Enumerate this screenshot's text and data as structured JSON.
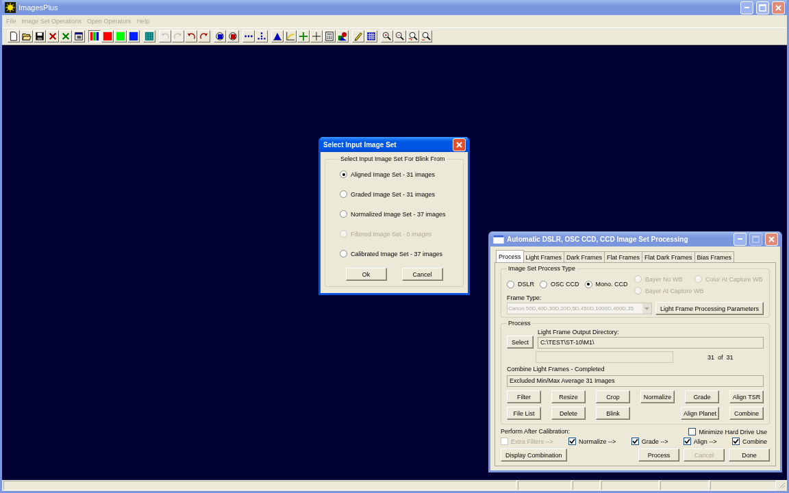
{
  "window": {
    "title": "ImagesPlus",
    "active": false
  },
  "menu": [
    {
      "label": "File",
      "disabled": true
    },
    {
      "label": "Image Set Operations",
      "disabled": true
    },
    {
      "label": "Open Operators",
      "disabled": true
    },
    {
      "label": "Help",
      "disabled": true
    }
  ],
  "toolbar": [
    [
      {
        "kind": "new",
        "disabled": false,
        "pressed": false
      },
      {
        "kind": "open",
        "disabled": false,
        "pressed": false
      },
      {
        "kind": "save",
        "disabled": false,
        "pressed": false
      },
      {
        "kind": "delete",
        "color": "#c00000",
        "disabled": false,
        "pressed": false
      },
      {
        "kind": "delete",
        "color": "#008000",
        "disabled": false,
        "pressed": false
      },
      {
        "kind": "window",
        "disabled": false,
        "pressed": false
      }
    ],
    [
      {
        "kind": "rgb",
        "disabled": false,
        "pressed": true
      },
      {
        "kind": "swatch",
        "color": "#ff0000",
        "disabled": false,
        "pressed": false
      },
      {
        "kind": "swatch",
        "color": "#00ff00",
        "disabled": false,
        "pressed": false
      },
      {
        "kind": "swatch",
        "color": "#0020ff",
        "disabled": false,
        "pressed": false
      }
    ],
    [
      {
        "kind": "dotted-square",
        "disabled": false,
        "pressed": false
      }
    ],
    [
      {
        "kind": "undo",
        "disabled": true,
        "pressed": false
      },
      {
        "kind": "redo",
        "disabled": true,
        "pressed": false
      },
      {
        "kind": "undo",
        "disabled": false,
        "pressed": false
      },
      {
        "kind": "redo",
        "disabled": false,
        "pressed": false
      }
    ],
    [
      {
        "kind": "circle",
        "color": "#0000c0",
        "disabled": false,
        "pressed": false
      },
      {
        "kind": "circle",
        "color": "#c00000",
        "disabled": false,
        "pressed": false
      }
    ],
    [
      {
        "kind": "dots",
        "disabled": false,
        "pressed": false
      },
      {
        "kind": "dot-pattern",
        "disabled": false,
        "pressed": false
      }
    ],
    [
      {
        "kind": "histogram",
        "disabled": false,
        "pressed": false
      },
      {
        "kind": "curve",
        "disabled": false,
        "pressed": false
      },
      {
        "kind": "plus",
        "disabled": false,
        "pressed": false
      },
      {
        "kind": "crosshair",
        "disabled": false,
        "pressed": false
      },
      {
        "kind": "calculator",
        "disabled": false,
        "pressed": false
      },
      {
        "kind": "shapes",
        "disabled": false,
        "pressed": false
      }
    ],
    [
      {
        "kind": "pencil",
        "disabled": false,
        "pressed": false
      },
      {
        "kind": "grid",
        "disabled": false,
        "pressed": false
      }
    ],
    [
      {
        "kind": "zoom-in",
        "disabled": false,
        "pressed": false
      },
      {
        "kind": "zoom-out",
        "disabled": false,
        "pressed": false
      },
      {
        "kind": "zoom-fit",
        "disabled": false,
        "pressed": false
      },
      {
        "kind": "zoom-reduce",
        "disabled": false,
        "pressed": false
      }
    ]
  ],
  "select_dialog": {
    "title": "Select Input Image Set",
    "active": true,
    "group_label": "Select Input Image Set For Blink From",
    "options": [
      {
        "label": "Aligned Image Set - 31 images",
        "selected": true,
        "disabled": false
      },
      {
        "label": "Graded Image Set - 31 images",
        "selected": false,
        "disabled": false
      },
      {
        "label": "Normalized Image Set - 37 images",
        "selected": false,
        "disabled": false
      },
      {
        "label": "Filtered Image Set - 0 images",
        "selected": false,
        "disabled": true
      },
      {
        "label": "Calibrated Image Set - 37 images",
        "selected": false,
        "disabled": false
      }
    ],
    "buttons": [
      {
        "label": "Ok",
        "disabled": false
      },
      {
        "label": "Cancel",
        "disabled": false
      }
    ]
  },
  "processing_dialog": {
    "title": "Automatic DSLR, OSC CCD, CCD Image Set Processing",
    "active": false,
    "tabs": [
      {
        "label": "Process",
        "selected": true
      },
      {
        "label": "Light Frames",
        "selected": false
      },
      {
        "label": "Dark Frames",
        "selected": false
      },
      {
        "label": "Flat Frames",
        "selected": false
      },
      {
        "label": "Flat Dark Frames",
        "selected": false
      },
      {
        "label": "Bias Frames",
        "selected": false
      }
    ],
    "process_type": {
      "label": "Image Set Process Type",
      "options": [
        {
          "label": "DSLR",
          "selected": false,
          "disabled": false
        },
        {
          "label": "OSC CCD",
          "selected": false,
          "disabled": false
        },
        {
          "label": "Mono. CCD",
          "selected": true,
          "disabled": false
        }
      ],
      "bayer_options": [
        {
          "label": "Bayer No WB",
          "selected": false,
          "disabled": true
        },
        {
          "label": "Color At Capture WB",
          "selected": false,
          "disabled": true
        },
        {
          "label": "Bayer At Capture WB",
          "selected": false,
          "disabled": true
        }
      ],
      "frame_type_label": "Frame Type:",
      "frame_type": {
        "value": "Canon 50D,40D,30D,20D,5D,450D,1000D,400D,35",
        "disabled": true
      },
      "parameters_button": {
        "label": "Light Frame Processing Parameters",
        "disabled": false
      }
    },
    "process": {
      "label": "Process",
      "select_button": {
        "label": "Select",
        "disabled": false
      },
      "output_label": "Light Frame Output Directory:",
      "output_directory": "C:\\TEST\\ST-10\\M1\\",
      "progress": {
        "level": 0
      },
      "count": "31  of  31",
      "status": "Combine Light Frames - Completed",
      "result": "Excluded Min/Max Average 31 Images",
      "button_rows": [
        {
          "left": [
            {
              "label": "Filter",
              "disabled": false
            },
            {
              "label": "Resize",
              "disabled": false
            },
            {
              "label": "Crop",
              "disabled": false
            },
            {
              "label": "Normalize",
              "disabled": false
            }
          ],
          "right": [
            {
              "label": "Grade",
              "disabled": false
            },
            {
              "label": "Align TSR",
              "disabled": false
            }
          ]
        },
        {
          "left": [
            {
              "label": "File List",
              "disabled": false
            },
            {
              "label": "Delete",
              "disabled": false
            },
            {
              "label": "Blink",
              "disabled": false
            }
          ],
          "right": [
            {
              "label": "Align Planet",
              "disabled": false
            },
            {
              "label": "Combine",
              "disabled": false
            }
          ]
        }
      ]
    },
    "after_label": "Perform After Calibration:",
    "minimize": {
      "label": "Minimize Hard Drive Use",
      "checked": false,
      "disabled": false
    },
    "after_steps": [
      {
        "label": "Extra Filters -->",
        "checked": false,
        "disabled": true
      },
      {
        "label": "Normalize -->",
        "checked": true,
        "disabled": false
      },
      {
        "label": "Grade -->",
        "checked": true,
        "disabled": false
      },
      {
        "label": "Align -->",
        "checked": true,
        "disabled": false
      },
      {
        "label": "Combine",
        "checked": true,
        "disabled": false
      }
    ],
    "display_button": {
      "label": "Display Combination",
      "disabled": false
    },
    "buttons": [
      {
        "label": "Process",
        "disabled": false
      },
      {
        "label": "Cancel",
        "disabled": true
      },
      {
        "label": "Done",
        "disabled": false
      }
    ]
  }
}
